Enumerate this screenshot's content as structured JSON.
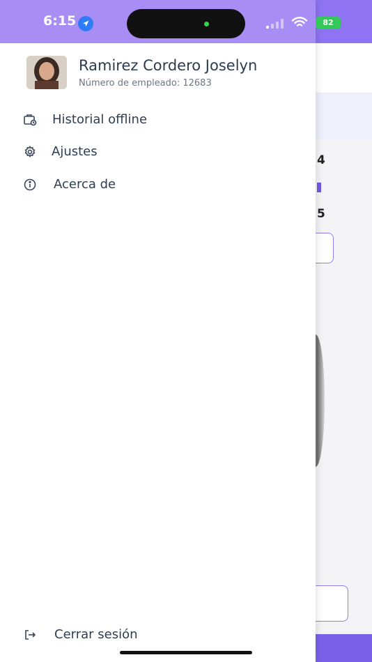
{
  "status_bar": {
    "time": "6:15",
    "battery": "82",
    "location_icon": "location-arrow-icon",
    "signal_icon": "cellular-signal-icon",
    "wifi_icon": "wifi-icon",
    "battery_icon": "battery-charging-icon"
  },
  "drawer": {
    "profile": {
      "name": "Ramirez Cordero Joselyn",
      "employee_number": "Número de empleado: 12683"
    },
    "menu": [
      {
        "label": "Historial offline",
        "icon": "offline-history-icon"
      },
      {
        "label": "Ajustes",
        "icon": "gear-icon"
      },
      {
        "label": "Acerca de",
        "icon": "info-icon"
      }
    ],
    "logout": {
      "label": "Cerrar sesión",
      "icon": "logout-icon"
    }
  },
  "background": {
    "fragments": [
      "4",
      "5"
    ]
  },
  "colors": {
    "accent": "#8e74f2",
    "drawer_header": "#a88df5",
    "text": "#2f3d52"
  }
}
